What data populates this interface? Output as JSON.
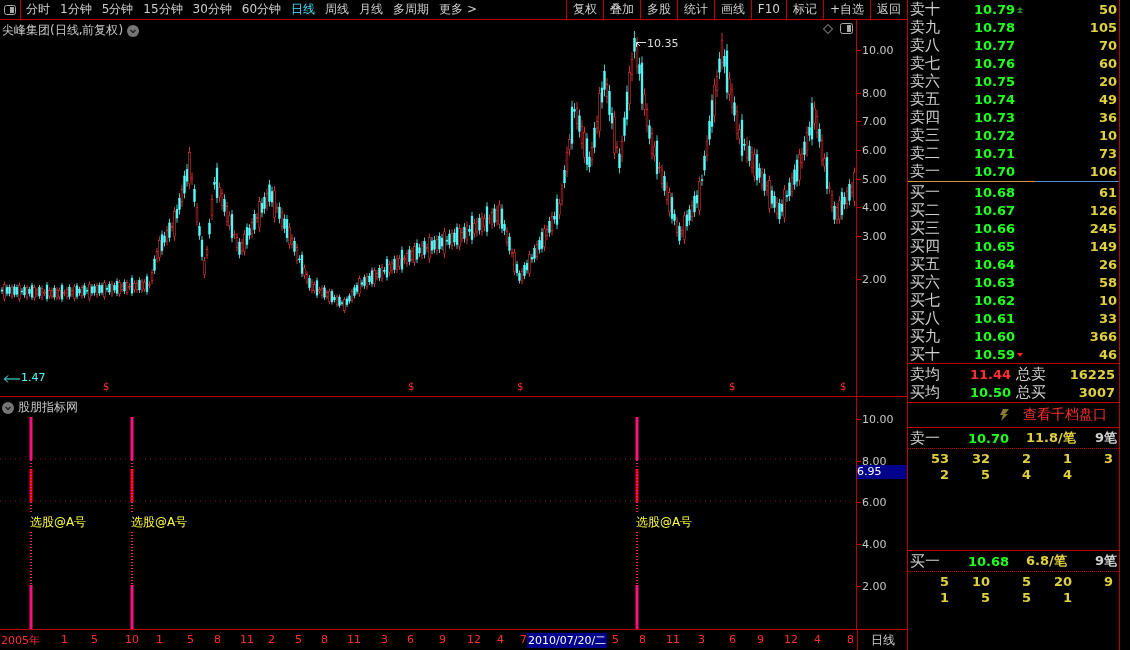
{
  "toolbar": {
    "periods": [
      {
        "label": "分时",
        "selected": false
      },
      {
        "label": "1分钟",
        "selected": false
      },
      {
        "label": "5分钟",
        "selected": false
      },
      {
        "label": "15分钟",
        "selected": false
      },
      {
        "label": "30分钟",
        "selected": false
      },
      {
        "label": "60分钟",
        "selected": false
      },
      {
        "label": "日线",
        "selected": true
      },
      {
        "label": "周线",
        "selected": false
      },
      {
        "label": "月线",
        "selected": false
      },
      {
        "label": "多周期",
        "selected": false
      }
    ],
    "more": "更多 >",
    "actions": [
      "复权",
      "叠加",
      "多股",
      "统计",
      "画线",
      "F10",
      "标记",
      "+自选",
      "返回"
    ]
  },
  "chart": {
    "title": "尖峰集团(日线,前复权)",
    "high_label": "10.35",
    "low_label": "1.47",
    "signal_marks": [
      "$",
      "$",
      "$",
      "$",
      "$"
    ],
    "price_axis": [
      "10.00",
      "8.00",
      "7.00",
      "6.00",
      "5.00",
      "4.00",
      "3.00",
      "2.00"
    ]
  },
  "indicator": {
    "title": "股朋指标网",
    "signals": [
      "选股@A号",
      "选股@A号",
      "选股@A号"
    ],
    "axis": [
      "10.00",
      "8.00",
      "6.00",
      "4.00",
      "2.00"
    ],
    "current_value": "6.95"
  },
  "time_axis": {
    "ticks": [
      {
        "label": "2005年",
        "selected": false
      },
      {
        "label": "1",
        "selected": false
      },
      {
        "label": "5",
        "selected": false
      },
      {
        "label": "10",
        "selected": false
      },
      {
        "label": "1",
        "selected": false
      },
      {
        "label": "5",
        "selected": false
      },
      {
        "label": "8",
        "selected": false
      },
      {
        "label": "11",
        "selected": false
      },
      {
        "label": "2",
        "selected": false
      },
      {
        "label": "5",
        "selected": false
      },
      {
        "label": "8",
        "selected": false
      },
      {
        "label": "11",
        "selected": false
      },
      {
        "label": "3",
        "selected": false
      },
      {
        "label": "6",
        "selected": false
      },
      {
        "label": "9",
        "selected": false
      },
      {
        "label": "12",
        "selected": false
      },
      {
        "label": "4",
        "selected": false
      },
      {
        "label": "7",
        "selected": false
      },
      {
        "label": "2010/07/20/二",
        "selected": true
      },
      {
        "label": "5",
        "selected": false
      },
      {
        "label": "8",
        "selected": false
      },
      {
        "label": "11",
        "selected": false
      },
      {
        "label": "3",
        "selected": false
      },
      {
        "label": "6",
        "selected": false
      },
      {
        "label": "9",
        "selected": false
      },
      {
        "label": "12",
        "selected": false
      },
      {
        "label": "4",
        "selected": false
      },
      {
        "label": "8",
        "selected": false
      }
    ],
    "period": "日线"
  },
  "order_book": {
    "asks": [
      {
        "label": "卖十",
        "price": "10.79",
        "volume": "50"
      },
      {
        "label": "卖九",
        "price": "10.78",
        "volume": "105"
      },
      {
        "label": "卖八",
        "price": "10.77",
        "volume": "70"
      },
      {
        "label": "卖七",
        "price": "10.76",
        "volume": "60"
      },
      {
        "label": "卖六",
        "price": "10.75",
        "volume": "20"
      },
      {
        "label": "卖五",
        "price": "10.74",
        "volume": "49"
      },
      {
        "label": "卖四",
        "price": "10.73",
        "volume": "36"
      },
      {
        "label": "卖三",
        "price": "10.72",
        "volume": "10"
      },
      {
        "label": "卖二",
        "price": "10.71",
        "volume": "73"
      },
      {
        "label": "卖一",
        "price": "10.70",
        "volume": "106"
      }
    ],
    "bids": [
      {
        "label": "买一",
        "price": "10.68",
        "volume": "61"
      },
      {
        "label": "买二",
        "price": "10.67",
        "volume": "126"
      },
      {
        "label": "买三",
        "price": "10.66",
        "volume": "245"
      },
      {
        "label": "买四",
        "price": "10.65",
        "volume": "149"
      },
      {
        "label": "买五",
        "price": "10.64",
        "volume": "26"
      },
      {
        "label": "买六",
        "price": "10.63",
        "volume": "58"
      },
      {
        "label": "买七",
        "price": "10.62",
        "volume": "10"
      },
      {
        "label": "买八",
        "price": "10.61",
        "volume": "33"
      },
      {
        "label": "买九",
        "price": "10.60",
        "volume": "366"
      },
      {
        "label": "买十",
        "price": "10.59",
        "volume": "46"
      }
    ],
    "totals": [
      {
        "label": "卖均",
        "price": "11.44",
        "up": true,
        "total_label": "总卖",
        "total": "16225"
      },
      {
        "label": "买均",
        "price": "10.50",
        "up": false,
        "total_label": "总买",
        "total": "3007"
      }
    ]
  },
  "queue": {
    "button": "查看千档盘口",
    "sides": [
      {
        "label": "卖一",
        "price": "10.70",
        "per_trade": "11.8/笔",
        "count": "9笔",
        "orders": [
          "53",
          "32",
          "2",
          "1",
          "3",
          "2",
          "5",
          "4",
          "4"
        ]
      },
      {
        "label": "买一",
        "price": "10.68",
        "per_trade": "6.8/笔",
        "count": "9笔",
        "orders": [
          "5",
          "10",
          "5",
          "20",
          "9",
          "1",
          "5",
          "5",
          "1"
        ]
      }
    ]
  }
}
